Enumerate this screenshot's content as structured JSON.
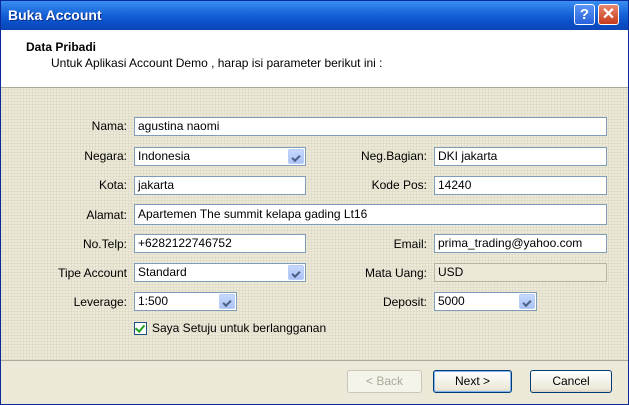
{
  "window": {
    "title": "Buka Account"
  },
  "header": {
    "title": "Data Pribadi",
    "subtitle": "Untuk Aplikasi Account Demo , harap isi parameter berikut ini :"
  },
  "form": {
    "nama": {
      "label": "Nama:",
      "value": "agustina naomi"
    },
    "negara": {
      "label": "Negara:",
      "value": "Indonesia"
    },
    "neg_bagian": {
      "label": "Neg.Bagian:",
      "value": "DKI jakarta"
    },
    "kota": {
      "label": "Kota:",
      "value": "jakarta"
    },
    "kode_pos": {
      "label": "Kode Pos:",
      "value": "14240"
    },
    "alamat": {
      "label": "Alamat:",
      "value": "Apartemen The summit kelapa gading Lt16"
    },
    "no_telp": {
      "label": "No.Telp:",
      "value": "+6282122746752"
    },
    "email": {
      "label": "Email:",
      "value": "prima_trading@yahoo.com"
    },
    "tipe_account": {
      "label": "Tipe Account",
      "value": "Standard"
    },
    "mata_uang": {
      "label": "Mata Uang:",
      "value": "USD"
    },
    "leverage": {
      "label": "Leverage:",
      "value": "1:500"
    },
    "deposit": {
      "label": "Deposit:",
      "value": "5000"
    },
    "agree": {
      "label": "Saya Setuju untuk berlangganan",
      "checked": true
    }
  },
  "buttons": {
    "back": "< Back",
    "next": "Next >",
    "cancel": "Cancel"
  },
  "icons": {
    "help": "?",
    "close": "✕"
  },
  "colors": {
    "titlebar": "#0a4fc7",
    "dialog_bg": "#ece9d8",
    "field_border": "#7f9db9",
    "checkmark": "#21a121"
  }
}
